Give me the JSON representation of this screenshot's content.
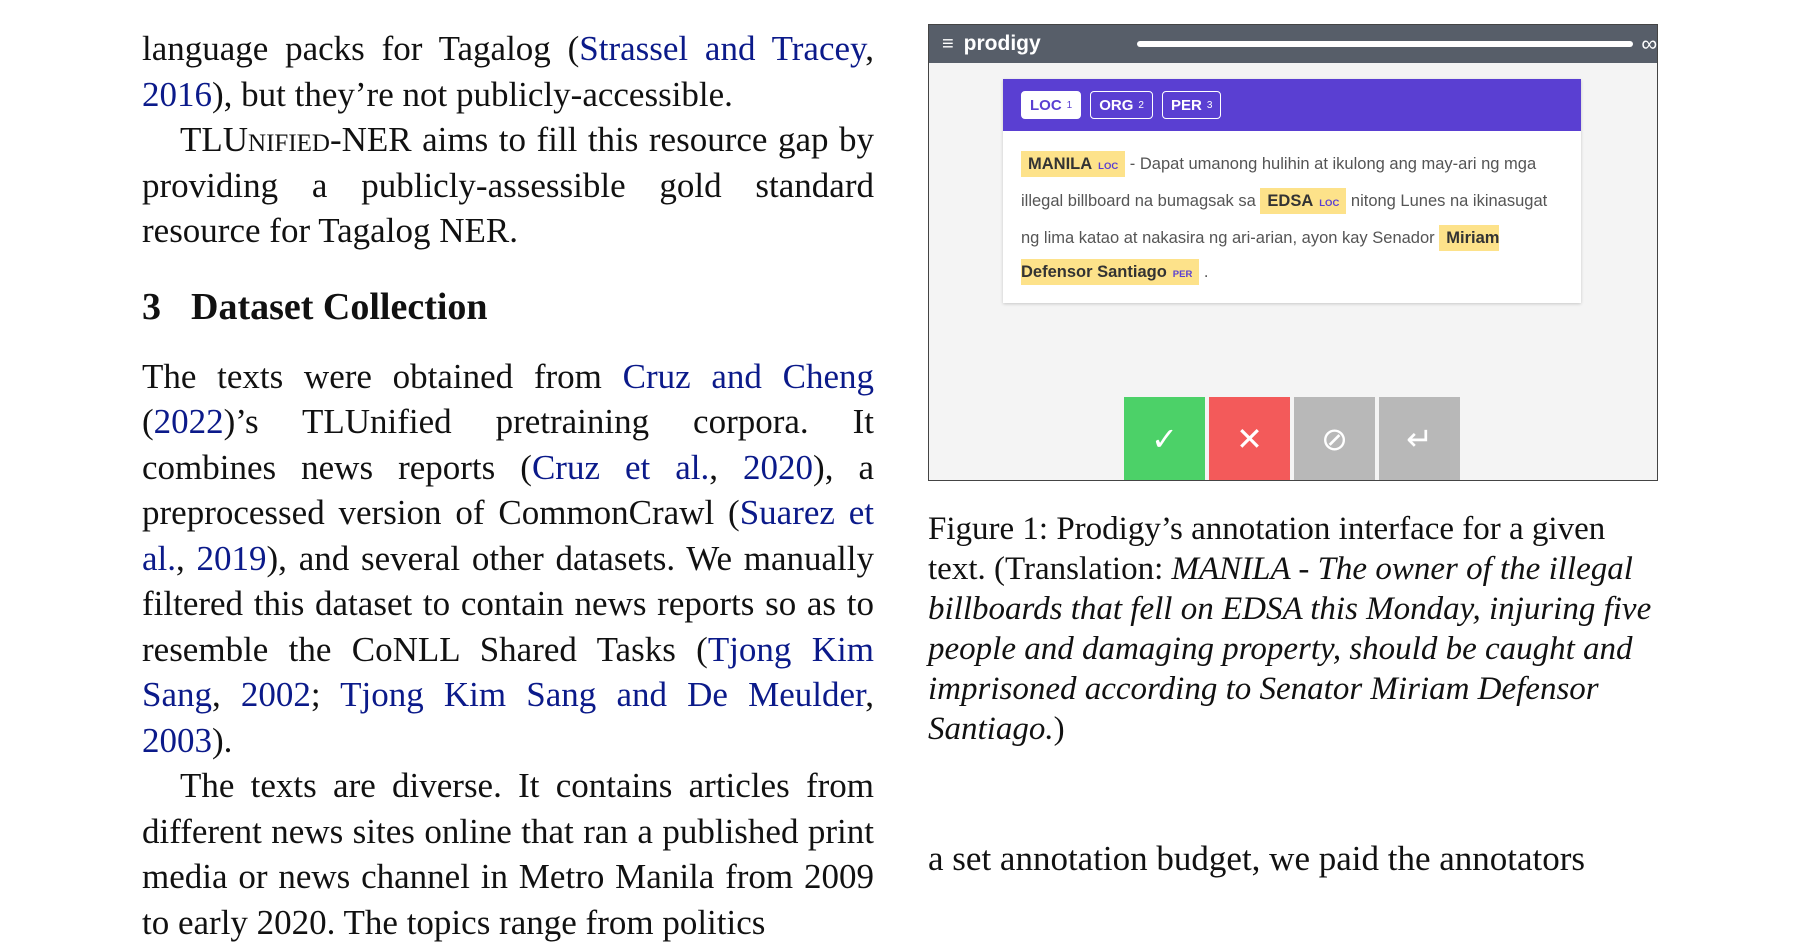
{
  "left": {
    "p1_text": "language packs for Tagalog (",
    "p1_cite_a": "Strassel and Tracey",
    "p1_sep": ", ",
    "p1_cite_b": "2016",
    "p1_end": "), but they’re not publicly-accessible.",
    "p2_sc": "TLUnified",
    "p2_text": "-NER aims to fill this resource gap by providing a publicly-assessible gold standard resource for Tagalog NER.",
    "section_num": "3",
    "section_title": "Dataset Collection",
    "p3_a": "The texts were obtained from ",
    "p3_c1": "Cruz and Cheng",
    "p3_b": " (",
    "p3_c2": "2022",
    "p3_c": ")’s TLUnified pretraining corpora. It combines news reports (",
    "p3_c3": "Cruz et al.",
    "p3_d": ", ",
    "p3_c4": "2020",
    "p3_e": "), a preprocessed version of CommonCrawl (",
    "p3_c5": "Suarez et al.",
    "p3_f": ", ",
    "p3_c6": "2019",
    "p3_g": "), and several other datasets. We manually filtered this dataset to contain news reports so as to resemble the CoNLL Shared Tasks (",
    "p3_c7": "Tjong Kim Sang",
    "p3_h": ", ",
    "p3_c8": "2002",
    "p3_i": "; ",
    "p3_c9": "Tjong Kim Sang and De Meulder",
    "p3_j": ", ",
    "p3_c10": "2003",
    "p3_k": ").",
    "p4": "The texts are diverse. It contains articles from different news sites online that ran a published print media or news channel in Metro Manila from 2009 to early 2020. The topics range from politics"
  },
  "figure": {
    "app_name": "prodigy",
    "menu_glyph": "≡",
    "infinity": "∞",
    "progress": 1.0,
    "labels": [
      {
        "name": "LOC",
        "key": "1"
      },
      {
        "name": "ORG",
        "key": "2"
      },
      {
        "name": "PER",
        "key": "3"
      }
    ],
    "ent1": "MANILA",
    "ent1_tag": "LOC",
    "t1": " - Dapat umanong hulihin at ikulong ang may-ari ng mga illegal billboard na bumagsak sa ",
    "ent2": "EDSA",
    "ent2_tag": "LOC",
    "t2": " nitong Lunes na ikinasugat ng lima katao at nakasira ng ari-arian, ayon kay Senador ",
    "ent3": "Miriam Defensor Santiago",
    "ent3_tag": "PER",
    "t3": " .",
    "actions": {
      "accept": "✓",
      "reject": "✕",
      "ignore": "⊘",
      "undo": "↵"
    },
    "colors": {
      "topbar": "#575e69",
      "header": "#5a3fd2",
      "highlight": "#fde28a",
      "accept": "#4cd168",
      "reject": "#f35a5a",
      "neutral": "#b8b8b8"
    }
  },
  "caption": {
    "prefix": "Figure 1: Prodigy’s annotation interface for a given text. (Translation: ",
    "italic": "MANILA - The owner of the illegal billboards that fell on EDSA this Monday, injuring five people and damaging property, should be caught and imprisoned according to Senator Miriam Defensor Santiago.",
    "suffix": ")"
  },
  "right_bottom": "a set annotation budget, we paid the annotators"
}
